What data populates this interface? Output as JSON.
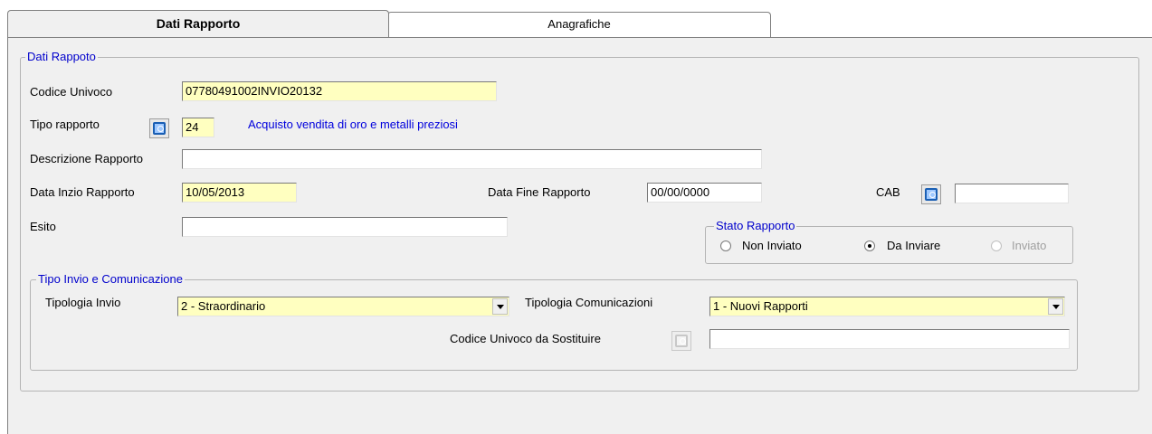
{
  "tabs": [
    {
      "label": "Dati Rapporto",
      "active": true
    },
    {
      "label": "Anagrafiche",
      "active": false
    }
  ],
  "dati_rapporto": {
    "group_title": "Dati Rappoto",
    "codice_univoco": {
      "label": "Codice Univoco",
      "value": "07780491002INVIO20132"
    },
    "tipo_rapporto": {
      "label": "Tipo rapporto",
      "value": "24",
      "description": "Acquisto vendita di oro e metalli preziosi"
    },
    "descrizione_rapporto": {
      "label": "Descrizione Rapporto",
      "value": ""
    },
    "data_inizio": {
      "label": "Data Inzio Rapporto",
      "value": "10/05/2013"
    },
    "data_fine": {
      "label": "Data Fine Rapporto",
      "value": "00/00/0000"
    },
    "cab": {
      "label": "CAB",
      "value": ""
    },
    "esito": {
      "label": "Esito",
      "value": ""
    },
    "stato_rapporto": {
      "title": "Stato Rapporto",
      "options": [
        {
          "label": "Non Inviato",
          "checked": false,
          "enabled": true
        },
        {
          "label": "Da Inviare",
          "checked": true,
          "enabled": true
        },
        {
          "label": "Inviato",
          "checked": false,
          "enabled": false
        }
      ]
    }
  },
  "tipo_invio": {
    "group_title": "Tipo Invio e Comunicazione",
    "tipologia_invio": {
      "label": "Tipologia Invio",
      "value": "2 - Straordinario"
    },
    "tipologia_comunicazioni": {
      "label": "Tipologia Comunicazioni",
      "value": "1 - Nuovi Rapporti"
    },
    "codice_sostituire": {
      "label": "Codice Univoco da Sostituire",
      "value": ""
    }
  },
  "colors": {
    "field_highlight": "#ffffc0",
    "group_title": "#0000cc",
    "link": "#0000dd",
    "panel": "#f0f0f0"
  },
  "icons": [
    "search-lookup-icon",
    "dropdown-arrow-icon",
    "radio-icon"
  ]
}
